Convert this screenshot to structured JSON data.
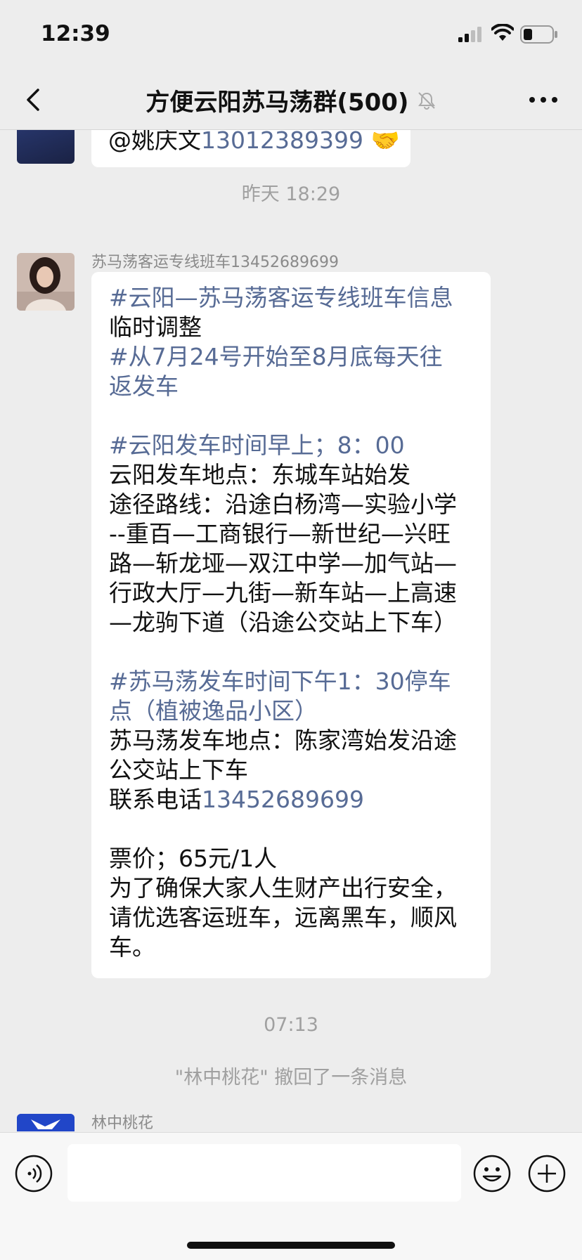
{
  "status_bar": {
    "time": "12:39"
  },
  "nav": {
    "title": "方便云阳苏马荡群(500)"
  },
  "messages": {
    "top_partial": {
      "prefix": "@姚庆文",
      "phone": "13012389399",
      "emoji": "🤝"
    },
    "timestamp_1": "昨天 18:29",
    "main": {
      "sender": "苏马荡客运专线班车13452689699",
      "lines": [
        "#云阳—苏马荡客运专线班车信息",
        "临时调整",
        "#从7月24号开始至8月底每天往",
        "返发车",
        "#云阳发车时间早上；8：00",
        "云阳发车地点：东城车站始发",
        "途径路线：沿途白杨湾—实验小学",
        "--重百—工商银行—新世纪—兴旺",
        "路—斩龙垭—双江中学—加气站—",
        "行政大厅—九街—新车站—上高速",
        "—龙驹下道（沿途公交站上下车）",
        "#苏马荡发车时间下午1：30停车",
        "点（植被逸品小区）",
        "苏马荡发车地点：陈家湾始发沿途",
        "公交站上下车",
        "联系电话",
        "13452689699",
        "票价；65元/1人",
        "为了确保大家人生财产出行安全，",
        "请优选客运班车，远离黑车，顺风",
        "车。"
      ]
    },
    "timestamp_2": "07:13",
    "recall_notice": "\"林中桃花\" 撤回了一条消息",
    "last_sender": "林中桃花"
  },
  "colors": {
    "background": "#ededed",
    "bubble": "#ffffff",
    "link": "#576b95",
    "meta": "#a0a0a0"
  }
}
